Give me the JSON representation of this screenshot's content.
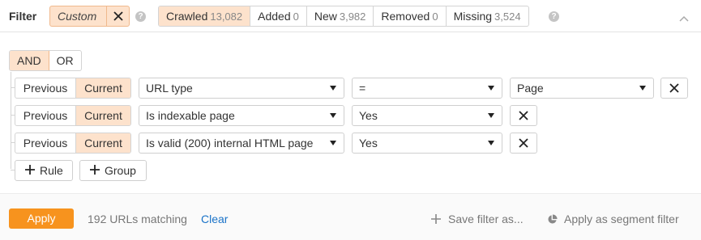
{
  "header": {
    "filter_label": "Filter",
    "custom_label": "Custom",
    "help_glyph": "?",
    "tabs": [
      {
        "label": "Crawled",
        "count": "13,082",
        "active": true
      },
      {
        "label": "Added",
        "count": "0",
        "active": false
      },
      {
        "label": "New",
        "count": "3,982",
        "active": false
      },
      {
        "label": "Removed",
        "count": "0",
        "active": false
      },
      {
        "label": "Missing",
        "count": "3,524",
        "active": false
      }
    ]
  },
  "logic": {
    "and_label": "AND",
    "or_label": "OR",
    "selected": "AND"
  },
  "rules": [
    {
      "previous_label": "Previous",
      "current_label": "Current",
      "selected": "Current",
      "field": "URL type",
      "operator": "=",
      "value": "Page",
      "value_is_select": true
    },
    {
      "previous_label": "Previous",
      "current_label": "Current",
      "selected": "Current",
      "field": "Is indexable page",
      "operator": "Yes",
      "value": null,
      "value_is_select": false
    },
    {
      "previous_label": "Previous",
      "current_label": "Current",
      "selected": "Current",
      "field": "Is valid (200) internal HTML page",
      "operator": "Yes",
      "value": null,
      "value_is_select": false
    }
  ],
  "actions": {
    "add_rule": "Rule",
    "add_group": "Group"
  },
  "footer": {
    "apply_label": "Apply",
    "matching_text": "192 URLs matching",
    "clear_label": "Clear",
    "save_label": "Save filter as...",
    "segment_label": "Apply as segment filter"
  },
  "colors": {
    "accent_orange": "#f7931e",
    "active_chip_bg": "#fde2cc",
    "link_blue": "#1a73c8"
  },
  "icons": [
    "close-icon",
    "help-icon",
    "chevron-up-icon",
    "dropdown-caret-icon",
    "plus-icon",
    "pie-chart-icon"
  ]
}
